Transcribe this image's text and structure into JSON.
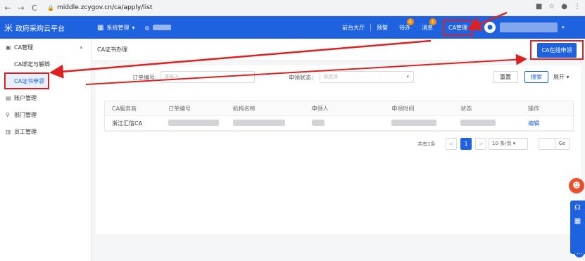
{
  "browser": {
    "back": "←",
    "forward": "→",
    "reload": "C",
    "url": "middle.zcygov.cn/ca/apply/list"
  },
  "topbar": {
    "logo_icon": "米",
    "logo_text": "政府采购云平台",
    "system_menu": "系统管理",
    "nav": {
      "hall": "前台大厅",
      "warning": "预警",
      "todo": "待办",
      "todo_badge": "4",
      "message": "消息",
      "message_badge": "1",
      "ca": "CA管理"
    }
  },
  "sidebar": {
    "items": [
      {
        "label": "CA管理",
        "icon": "ca-icon"
      },
      {
        "label": "CA绑定与解绑"
      },
      {
        "label": "CA证书申领"
      },
      {
        "label": "账户管理",
        "icon": "account-icon"
      },
      {
        "label": "部门管理",
        "icon": "org-icon"
      },
      {
        "label": "员工管理",
        "icon": "staff-icon"
      }
    ]
  },
  "main": {
    "page_title": "CA证书办理",
    "apply_button": "CA在线申领",
    "filters": {
      "order_label": "订单编号:",
      "order_placeholder": "请输入",
      "status_label": "申领状态:",
      "status_placeholder": "请选择",
      "reset": "重置",
      "search": "搜索",
      "expand": "展开"
    },
    "table": {
      "headers": [
        "CA服务商",
        "订单编号",
        "机构名称",
        "申领人",
        "申领时间",
        "状态",
        "操作"
      ],
      "rows": [
        {
          "provider": "浙江汇信CA",
          "action": "编辑"
        }
      ]
    },
    "pager": {
      "total": "共有1条",
      "prev": "<",
      "current": "1",
      "next": ">",
      "page_size": "10 条/页",
      "go": "Go"
    }
  },
  "colors": {
    "primary": "#1e62e0",
    "highlight_annotation": "#e02020",
    "badge": "#ff8a00"
  }
}
